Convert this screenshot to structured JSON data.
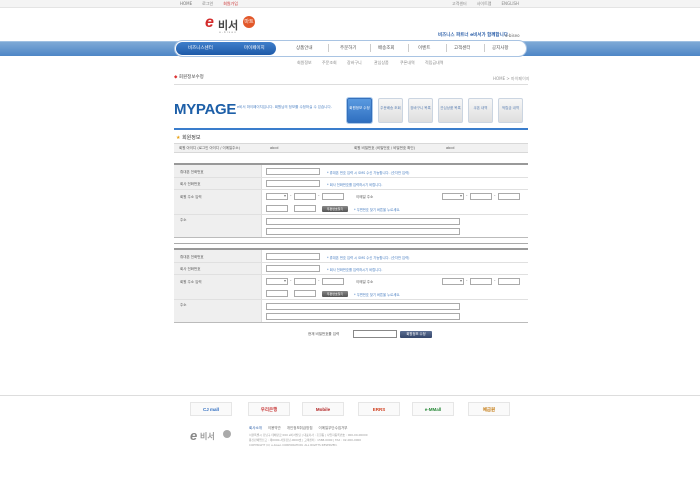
{
  "topbar": {
    "links": [
      "HOME",
      "로그인",
      "회원가입"
    ],
    "right": [
      "고객센터",
      "사이트맵",
      "ENGLISH"
    ]
  },
  "logo": {
    "e": "e",
    "text": "비서",
    "badge": "마트",
    "sub": "e-biseo"
  },
  "header": {
    "slogan": "비즈니스 파트너 e비서가 함께합니다",
    "slogan_en": "e-biseo"
  },
  "nav": {
    "left": [
      "비즈니스센터",
      "마이페이지"
    ],
    "items": [
      "상품안내",
      "주문하기",
      "배송조회",
      "이벤트",
      "고객센터",
      "공지사항"
    ]
  },
  "subnav": [
    "회원정보",
    "주문조회",
    "장바구니",
    "관심상품",
    "쿠폰내역",
    "적립금내역"
  ],
  "breadcrumb": {
    "mark": "◆",
    "title": "회원정보수정",
    "path": "HOME > 마이페이지"
  },
  "mypage": {
    "title": "MYPAGE",
    "desc": "e비서 마이페이지입니다. 회원님의 정보를 수정하실 수 있습니다."
  },
  "tabs": [
    "회원정보 수정",
    "주문배송 조회",
    "장바구니 목록",
    "관심상품 목록",
    "쿠폰 내역",
    "적립금 내역"
  ],
  "section": {
    "star": "★",
    "title": "회원정보"
  },
  "inforow": {
    "l1": "회원 아이디 (로그인 아이디 / 이메일주소)",
    "v1": "abcd",
    "l2": "회원 비밀번호 (비밀번호 / 비밀번호 확인)",
    "v2": "abcd"
  },
  "form1": {
    "labels": [
      "휴대폰 전화번호",
      "회사 전화번호",
      "회원 주소 입력",
      "주소"
    ],
    "note1": "* 휴대폰 번호 입력 시 SMS 수신 가능합니다. (숫자만 입력)",
    "note2": "* 회사 전화번호를 입력하시기 바랍니다.",
    "email_label": "이메일 주소",
    "zip_btn": "우편번호찾기",
    "note3": "* 우편번호 찾기 버튼을 누르세요."
  },
  "form2": {
    "labels": [
      "휴대폰 전화번호",
      "회사 전화번호",
      "회원 주소 입력",
      "주소"
    ],
    "note1": "* 휴대폰 번호 입력 시 SMS 수신 가능합니다. (숫자만 입력)",
    "note2": "* 회사 전화번호를 입력하시기 바랍니다.",
    "email_label": "이메일 주소",
    "zip_btn": "우편번호찾기",
    "note3": "* 우편번호 찾기 버튼을 누르세요."
  },
  "confirm": {
    "label": "현재 비밀번호를 입력",
    "button": "회원정보 수정"
  },
  "partners": [
    "CJ mall",
    "우리은행",
    "Mobile",
    "ERRS",
    "e-MMall",
    "예금원"
  ],
  "footer": {
    "links": [
      "회사소개",
      "이용약관",
      "개인정보취급방침",
      "이메일무단수집거부"
    ],
    "lines": [
      "서울특별시 강남구 테헤란로 000 e비서빌딩 | 대표이사 : 홍길동 | 사업자등록번호 : 000-00-00000",
      "통신판매업신고 : 제0000-서울강남-0000호 | 고객센터 : 1588-0000 | FAX : 02-000-0000",
      "COPYRIGHT (C) e-biseo CORPORATION. ALL RIGHTS RESERVED."
    ]
  }
}
